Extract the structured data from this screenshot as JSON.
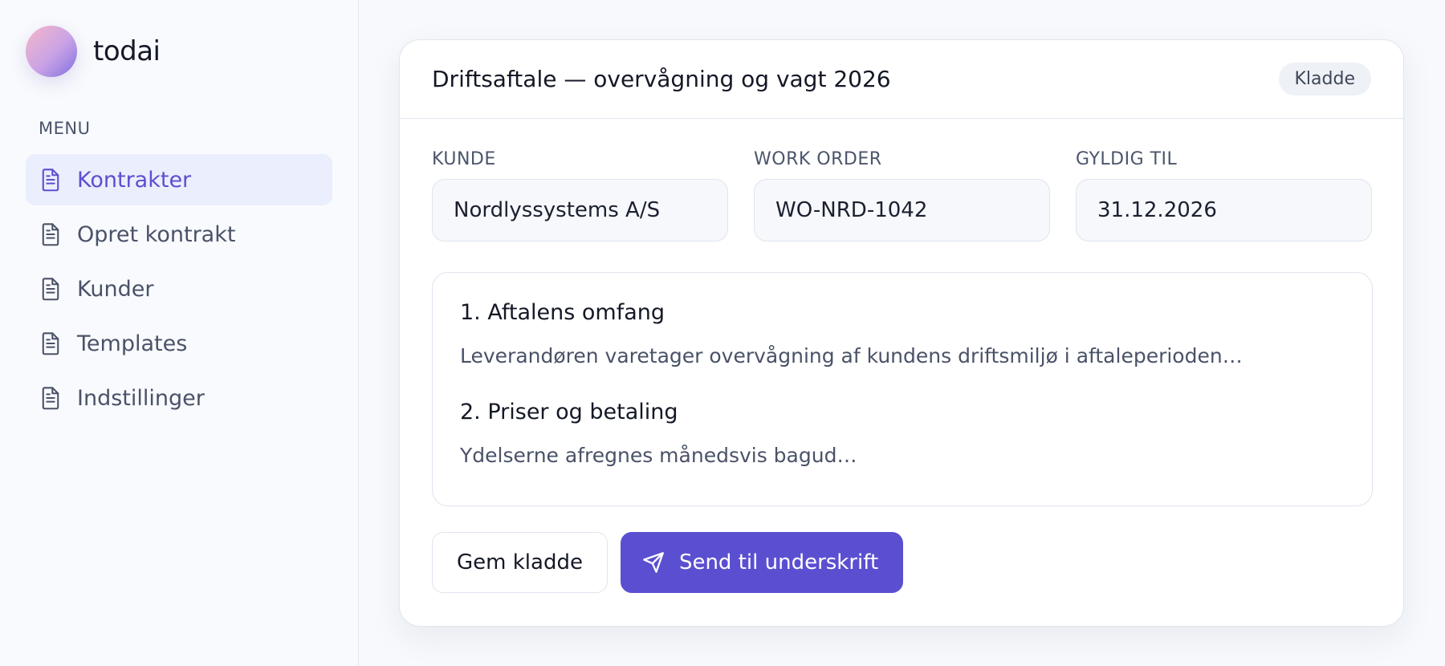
{
  "brand": {
    "name": "todai"
  },
  "sidebar": {
    "menu_label": "MENU",
    "items": [
      {
        "label": "Kontrakter",
        "icon": "document-icon",
        "active": true
      },
      {
        "label": "Opret kontrakt",
        "icon": "document-icon",
        "active": false
      },
      {
        "label": "Kunder",
        "icon": "document-icon",
        "active": false
      },
      {
        "label": "Templates",
        "icon": "document-icon",
        "active": false
      },
      {
        "label": "Indstillinger",
        "icon": "document-icon",
        "active": false
      }
    ]
  },
  "contract": {
    "title": "Driftsaftale — overvågning og vagt 2026",
    "status": "Kladde",
    "fields": {
      "customer": {
        "label": "KUNDE",
        "value": "Nordlyssystems A/S"
      },
      "work_order": {
        "label": "WORK ORDER",
        "value": "WO-NRD-1042"
      },
      "valid_until": {
        "label": "GYLDIG TIL",
        "value": "31.12.2026"
      }
    },
    "sections": [
      {
        "title": "1. Aftalens omfang",
        "text": "Leverandøren varetager overvågning af kundens driftsmiljø i aftaleperioden…"
      },
      {
        "title": "2. Priser og betaling",
        "text": "Ydelserne afregnes månedsvis bagud…"
      }
    ],
    "actions": {
      "save_draft": "Gem kladde",
      "send_signature": "Send til underskrift"
    }
  },
  "colors": {
    "accent": "#5b4fd1",
    "active_nav_bg": "#ebeefd",
    "badge_bg": "#eef1f6"
  }
}
